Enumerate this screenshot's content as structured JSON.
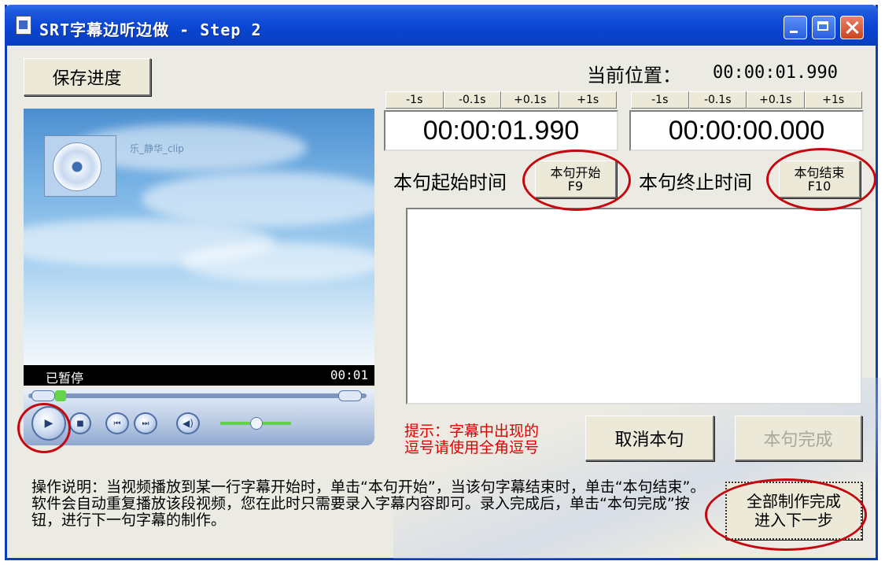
{
  "window": {
    "title": "SRT字幕边听边做 - Step 2"
  },
  "toolbar": {
    "save_label": "保存进度"
  },
  "position": {
    "label": "当前位置：",
    "value": "00:00:01.990"
  },
  "adjust_buttons": [
    "-1s",
    "-0.1s",
    "+0.1s",
    "+1s"
  ],
  "start": {
    "time": "00:00:01.990",
    "label": "本句起始时间",
    "button": "本句开始\nF9"
  },
  "end": {
    "time": "00:00:00.000",
    "label": "本句终止时间",
    "button": "本句结束\nF10"
  },
  "subtitle_input": {
    "value": ""
  },
  "tip": "提示：字幕中出现的\n逗号请使用全角逗号",
  "actions": {
    "cancel": "取消本句",
    "done": "本句完成",
    "finish_all": "全部制作完成\n进入下一步"
  },
  "instructions": "操作说明：当视频播放到某一行字幕开始时，单击“本句开始”，当该句字幕结束时，单击“本句结束”。软件会自动重复播放该段视频，您在此时只需要录入字幕内容即可。录入完成后，单击“本句完成”按钮，进行下一句字幕的制作。",
  "player": {
    "caption": "乐_静华_clip",
    "status": "已暂停",
    "time": "00:01",
    "icons": [
      "play-icon",
      "stop-icon",
      "previous-icon",
      "next-icon",
      "mute-icon",
      "volume-slider"
    ]
  },
  "colors": {
    "titlebar": "#0a46d3",
    "highlight_ring": "#c5080f",
    "tip_text": "#e00000"
  }
}
